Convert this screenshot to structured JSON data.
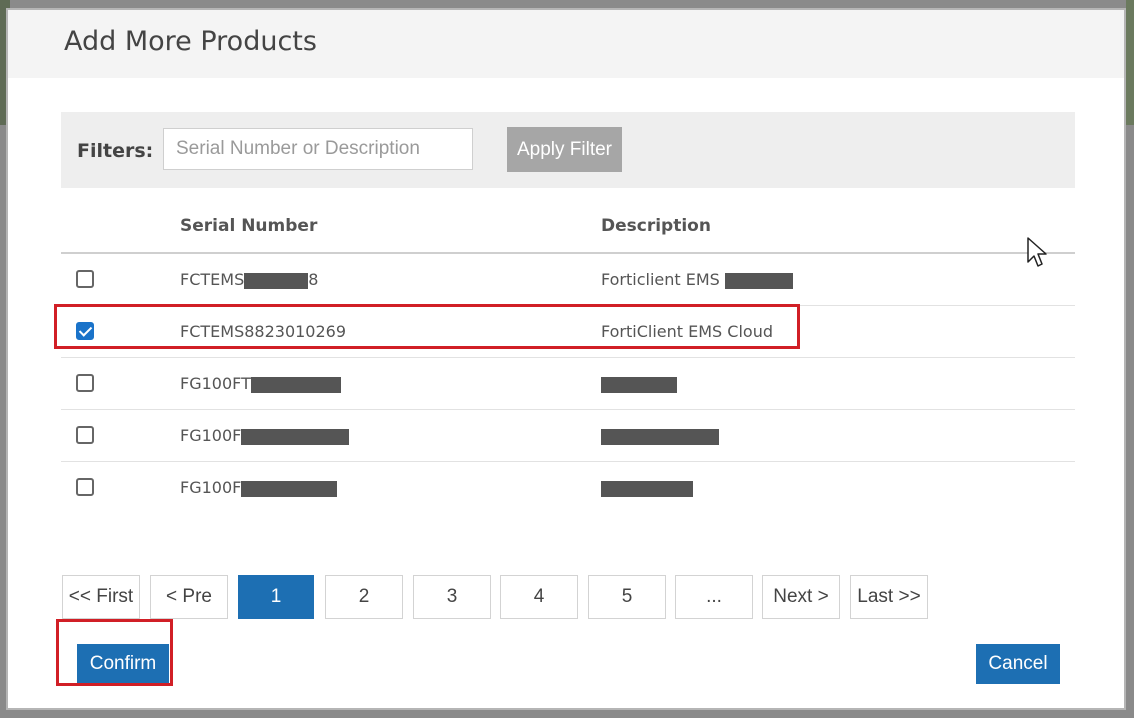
{
  "modal": {
    "title": "Add More Products"
  },
  "filter": {
    "label": "Filters:",
    "placeholder": "Serial Number or Description",
    "apply_label": "Apply Filter"
  },
  "table": {
    "columns": [
      "Serial Number",
      "Description"
    ],
    "rows": [
      {
        "serial": "FCTEMS",
        "serial_suffix": "8",
        "description": "Forticlient EMS ",
        "checked": false,
        "redacted": true
      },
      {
        "serial": "FCTEMS8823010269",
        "description": "FortiClient EMS Cloud",
        "checked": true,
        "redacted": false
      },
      {
        "serial": "FG100FT",
        "description": "",
        "checked": false,
        "redacted": true
      },
      {
        "serial": "FG100F",
        "description": "",
        "checked": false,
        "redacted": true
      },
      {
        "serial": "FG100F",
        "description": "",
        "checked": false,
        "redacted": true
      }
    ]
  },
  "pagination": {
    "first": "<< First",
    "prev": "< Pre",
    "pages": [
      "1",
      "2",
      "3",
      "4",
      "5",
      "..."
    ],
    "current_page": "1",
    "next": "Next >",
    "last": "Last >>"
  },
  "actions": {
    "confirm_label": "Confirm",
    "cancel_label": "Cancel"
  },
  "colors": {
    "primary": "#1d6fb3",
    "highlight_red": "#d11f26",
    "apply_disabled": "#a6a6a6"
  }
}
